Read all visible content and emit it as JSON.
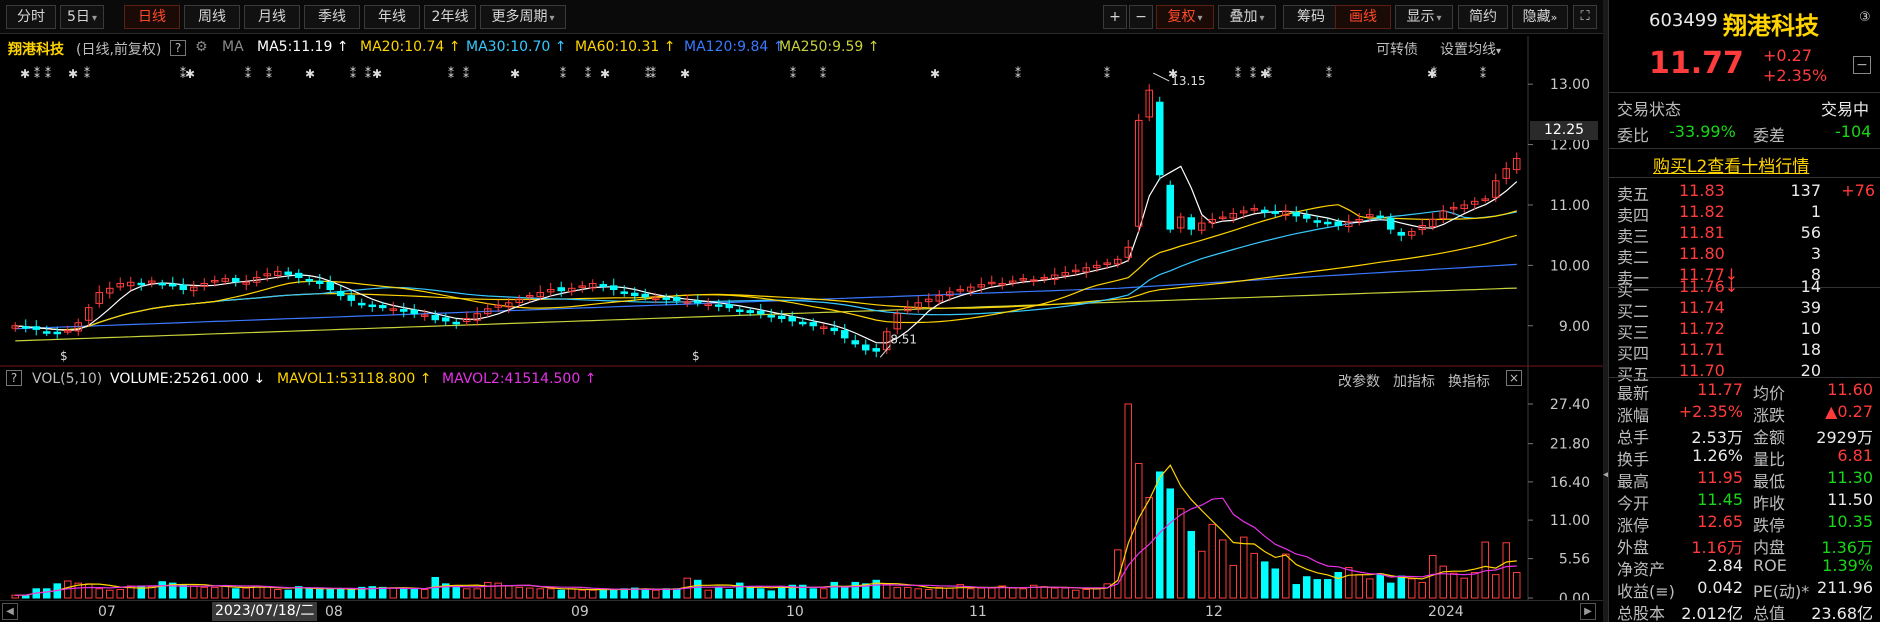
{
  "toolbar": {
    "items": [
      "分时",
      "5日",
      "日线",
      "周线",
      "月线",
      "季线",
      "年线",
      "2年线",
      "更多周期"
    ],
    "active": "日线",
    "right_items": [
      "+",
      "−",
      "复权",
      "叠加",
      "筹码",
      "画线",
      "显示",
      "简约",
      "隐藏"
    ],
    "right_active": [
      "复权",
      "画线"
    ]
  },
  "main_legend": {
    "stock": "翔港科技",
    "mode": "(日线,前复权)",
    "ma_label": "MA",
    "ma5": "MA5:11.19",
    "ma20": "MA20:10.74",
    "ma30": "MA30:10.70",
    "ma60": "MA60:10.31",
    "ma120": "MA120:9.84",
    "ma250": "MA250:9.59",
    "convertible": "可转债",
    "ma_settings": "设置均线"
  },
  "colors": {
    "up": "#ff3b3b",
    "down": "#00ffff",
    "ma5": "#ffffff",
    "ma20": "#ffd400",
    "ma30": "#36c8ff",
    "ma60": "#ffd400",
    "ma120": "#3a78ff",
    "ma250": "#c8d23a",
    "mavol1": "#ffd400",
    "mavol2": "#e632e6"
  },
  "price_axis": [
    "13.00",
    "12.00",
    "11.00",
    "10.00",
    "9.00"
  ],
  "price_tag": "12.25",
  "annotations": {
    "high": "13.15",
    "low": "8.51"
  },
  "vol_legend": {
    "title": "VOL(5,10)",
    "volume": "VOLUME:25261.000",
    "mavol1": "MAVOL1:53118.800",
    "mavol2": "MAVOL2:41514.500",
    "params": "改参数",
    "add": "加指标",
    "switch": "换指标"
  },
  "vol_axis": [
    "27.40",
    "21.80",
    "16.40",
    "11.00",
    "5.56",
    "0.00"
  ],
  "date_axis": {
    "months": [
      "07",
      "08",
      "09",
      "10",
      "11",
      "12",
      "2024"
    ],
    "cursor_date": "2023/07/18/二"
  },
  "quote": {
    "code": "603499",
    "name": "翔港科技",
    "badge": "③",
    "price": "11.77",
    "change": "+0.27",
    "change_pct": "+2.35%",
    "status_label": "交易状态",
    "status": "交易中",
    "weibi_label": "委比",
    "weibi": "-33.99%",
    "weicha_label": "委差",
    "weicha": "-104",
    "l2_link": "购买L2查看十档行情",
    "asks": [
      {
        "label": "卖五",
        "price": "11.83",
        "vol": "137",
        "delta": "+76"
      },
      {
        "label": "卖四",
        "price": "11.82",
        "vol": "1",
        "delta": ""
      },
      {
        "label": "卖三",
        "price": "11.81",
        "vol": "56",
        "delta": ""
      },
      {
        "label": "卖二",
        "price": "11.80",
        "vol": "3",
        "delta": ""
      },
      {
        "label": "卖一",
        "price": "11.77↓",
        "vol": "8",
        "delta": ""
      }
    ],
    "bids": [
      {
        "label": "买一",
        "price": "11.76↓",
        "vol": "14"
      },
      {
        "label": "买二",
        "price": "11.74",
        "vol": "39"
      },
      {
        "label": "买三",
        "price": "11.72",
        "vol": "10"
      },
      {
        "label": "买四",
        "price": "11.71",
        "vol": "18"
      },
      {
        "label": "买五",
        "price": "11.70",
        "vol": "20"
      }
    ],
    "stats": [
      {
        "l1": "最新",
        "v1": "11.77",
        "l2": "均价",
        "v2": "11.60"
      },
      {
        "l1": "涨幅",
        "v1": "+2.35%",
        "l2": "涨跌",
        "v2": "▲0.27"
      },
      {
        "l1": "总手",
        "v1": "2.53万",
        "l2": "金额",
        "v2": "2929万"
      },
      {
        "l1": "换手",
        "v1": "1.26%",
        "l2": "量比",
        "v2": "6.81"
      },
      {
        "l1": "最高",
        "v1": "11.95",
        "l2": "最低",
        "v2": "11.30"
      },
      {
        "l1": "今开",
        "v1": "11.45",
        "l2": "昨收",
        "v2": "11.50"
      },
      {
        "l1": "涨停",
        "v1": "12.65",
        "l2": "跌停",
        "v2": "10.35"
      },
      {
        "l1": "外盘",
        "v1": "1.16万",
        "l2": "内盘",
        "v2": "1.36万"
      },
      {
        "l1": "净资产",
        "v1": "2.84",
        "l2": "ROE",
        "v2": "1.39%"
      },
      {
        "l1": "收益(≡)",
        "v1": "0.042",
        "l2": "PE(动)*",
        "v2": "211.96"
      },
      {
        "l1": "总股本",
        "v1": "2.012亿",
        "l2": "总值",
        "v2": "23.68亿"
      }
    ]
  },
  "chart_data": {
    "type": "candlestick",
    "price_range": [
      8.4,
      13.4
    ],
    "volume_range": [
      0,
      27.4
    ],
    "notable": {
      "high": 13.15,
      "low": 8.51
    },
    "closes": [
      9.0,
      8.97,
      8.94,
      8.9,
      8.88,
      8.92,
      9.05,
      9.3,
      9.55,
      9.62,
      9.7,
      9.72,
      9.68,
      9.74,
      9.7,
      9.66,
      9.6,
      9.64,
      9.7,
      9.75,
      9.78,
      9.73,
      9.72,
      9.8,
      9.86,
      9.9,
      9.85,
      9.8,
      9.74,
      9.7,
      9.6,
      9.5,
      9.42,
      9.36,
      9.32,
      9.3,
      9.28,
      9.24,
      9.2,
      9.18,
      9.1,
      9.08,
      9.05,
      9.12,
      9.2,
      9.28,
      9.34,
      9.38,
      9.44,
      9.5,
      9.55,
      9.6,
      9.58,
      9.62,
      9.66,
      9.7,
      9.65,
      9.6,
      9.55,
      9.5,
      9.48,
      9.46,
      9.44,
      9.42,
      9.4,
      9.38,
      9.36,
      9.34,
      9.3,
      9.26,
      9.22,
      9.2,
      9.16,
      9.12,
      9.08,
      9.05,
      9.0,
      8.98,
      8.92,
      8.8,
      8.7,
      8.6,
      8.58,
      8.9,
      9.2,
      9.3,
      9.38,
      9.44,
      9.5,
      9.56,
      9.6,
      9.64,
      9.68,
      9.72,
      9.7,
      9.74,
      9.78,
      9.76,
      9.8,
      9.84,
      9.88,
      9.92,
      9.96,
      10.0,
      10.04,
      10.1,
      10.3,
      12.4,
      12.9,
      11.5,
      10.6,
      10.8,
      10.6,
      10.7,
      10.76,
      10.8,
      10.86,
      10.9,
      10.94,
      10.88,
      10.86,
      10.9,
      10.82,
      10.78,
      10.72,
      10.7,
      10.66,
      10.72,
      10.76,
      10.84,
      10.8,
      10.6,
      10.5,
      10.56,
      10.66,
      10.76,
      10.9,
      10.96,
      11.0,
      11.06,
      11.1,
      11.4,
      11.6,
      11.77
    ],
    "volumes": [
      0.4,
      0.4,
      1.3,
      1.3,
      2.0,
      2.4,
      2.1,
      2.0,
      1.3,
      1.1,
      1.2,
      1.7,
      1.7,
      1.6,
      2.3,
      2.1,
      1.8,
      1.7,
      1.5,
      1.5,
      1.7,
      1.3,
      1.4,
      1.7,
      1.6,
      1.2,
      1.1,
      1.6,
      1.4,
      1.3,
      1.2,
      1.2,
      1.2,
      1.5,
      1.6,
      1.5,
      1.4,
      1.3,
      1.2,
      1.2,
      2.9,
      2.0,
      1.6,
      1.3,
      1.3,
      2.2,
      2.1,
      1.7,
      1.5,
      1.4,
      1.3,
      1.3,
      1.1,
      1.3,
      1.1,
      1.1,
      1.3,
      1.2,
      1.3,
      1.4,
      1.2,
      1.1,
      1.3,
      1.3,
      2.8,
      2.5,
      1.1,
      1.5,
      1.2,
      2.1,
      1.6,
      1.3,
      1.0,
      1.6,
      1.8,
      1.8,
      1.3,
      1.3,
      2.2,
      1.6,
      2.2,
      2.0,
      2.5,
      1.9,
      1.5,
      1.5,
      1.3,
      1.2,
      1.5,
      1.4,
      1.9,
      1.3,
      1.4,
      1.4,
      1.7,
      1.4,
      1.3,
      1.8,
      1.6,
      1.4,
      1.4,
      1.1,
      1.2,
      1.3,
      2.0,
      6.8,
      27.4,
      19.0,
      14.2,
      17.8,
      15.4,
      12.6,
      9.4,
      6.6,
      10.4,
      8.2,
      4.6,
      8.6,
      6.3,
      5.1,
      4.1,
      6.2,
      1.9,
      3.0,
      2.6,
      2.6,
      3.6,
      4.3,
      3.3,
      2.7,
      3.4,
      2.1,
      3.1,
      2.7,
      2.2,
      6.0,
      4.5,
      3.5,
      2.8,
      3.6,
      7.9,
      3.3,
      7.8,
      3.6
    ]
  }
}
